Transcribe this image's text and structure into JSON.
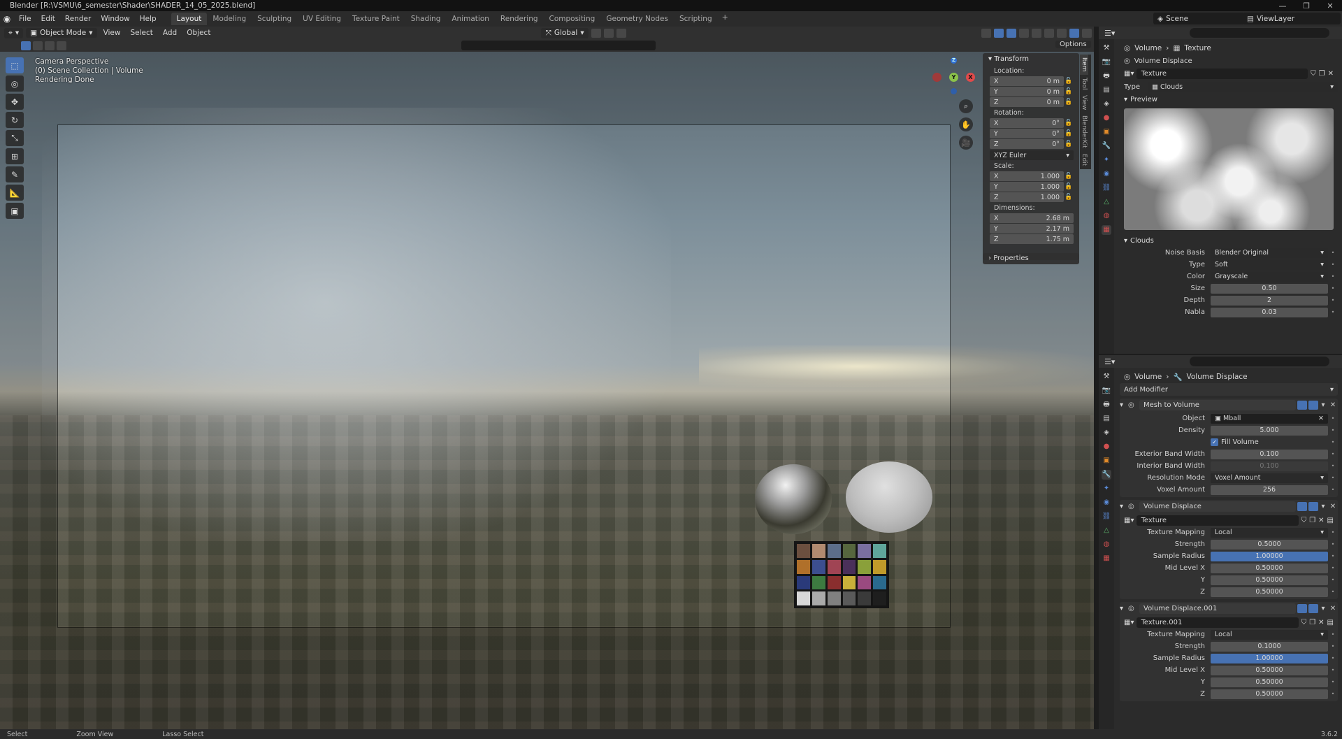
{
  "window": {
    "title": "Blender [R:\\VSMU\\6_semester\\Shader\\SHADER_14_05_2025.blend]",
    "buttons": [
      "—",
      "❐",
      "✕"
    ]
  },
  "menus": [
    "File",
    "Edit",
    "Render",
    "Window",
    "Help"
  ],
  "workspaces": [
    {
      "label": "Layout",
      "active": true
    },
    {
      "label": "Modeling"
    },
    {
      "label": "Sculpting"
    },
    {
      "label": "UV Editing"
    },
    {
      "label": "Texture Paint"
    },
    {
      "label": "Shading"
    },
    {
      "label": "Animation"
    },
    {
      "label": "Rendering"
    },
    {
      "label": "Compositing"
    },
    {
      "label": "Geometry Nodes"
    },
    {
      "label": "Scripting"
    }
  ],
  "scene": {
    "name": "Scene",
    "view_layer": "ViewLayer"
  },
  "viewport_header": {
    "mode": "Object Mode",
    "menus": [
      "View",
      "Select",
      "Add",
      "Object"
    ],
    "orientation": "Global",
    "options": "Options"
  },
  "viewport": {
    "info": [
      "Camera Perspective",
      "(0) Scene Collection | Volume",
      "Rendering Done"
    ],
    "gizmo": {
      "z": "Z",
      "y": "Y",
      "x": "X"
    }
  },
  "npanel": {
    "section": "Transform",
    "location_label": "Location:",
    "location": [
      {
        "axis": "X",
        "value": "0 m"
      },
      {
        "axis": "Y",
        "value": "0 m"
      },
      {
        "axis": "Z",
        "value": "0 m"
      }
    ],
    "rotation_label": "Rotation:",
    "rotation": [
      {
        "axis": "X",
        "value": "0°"
      },
      {
        "axis": "Y",
        "value": "0°"
      },
      {
        "axis": "Z",
        "value": "0°"
      }
    ],
    "rotation_mode": "XYZ Euler",
    "scale_label": "Scale:",
    "scale": [
      {
        "axis": "X",
        "value": "1.000"
      },
      {
        "axis": "Y",
        "value": "1.000"
      },
      {
        "axis": "Z",
        "value": "1.000"
      }
    ],
    "dimensions_label": "Dimensions:",
    "dimensions": [
      {
        "axis": "X",
        "value": "2.68 m"
      },
      {
        "axis": "Y",
        "value": "2.17 m"
      },
      {
        "axis": "Z",
        "value": "1.75 m"
      }
    ],
    "properties": "Properties",
    "tabs": [
      "Item",
      "Tool",
      "View",
      "BlenderKit",
      "Edit"
    ]
  },
  "texture_panel": {
    "crumb_object": "Volume",
    "crumb_item": "Texture",
    "modifier_name": "Volume Displace",
    "texture_name": "Texture",
    "type_label": "Type",
    "type_value": "Clouds",
    "preview_label": "Preview",
    "clouds_label": "Clouds",
    "props": [
      {
        "label": "Noise Basis",
        "value": "Blender Original",
        "kind": "select"
      },
      {
        "label": "Type",
        "value": "Soft",
        "kind": "select"
      },
      {
        "label": "Color",
        "value": "Grayscale",
        "kind": "select"
      },
      {
        "label": "Size",
        "value": "0.50",
        "kind": "num"
      },
      {
        "label": "Depth",
        "value": "2",
        "kind": "num"
      },
      {
        "label": "Nabla",
        "value": "0.03",
        "kind": "num"
      }
    ]
  },
  "modifier_panel": {
    "crumb_object": "Volume",
    "crumb_item": "Volume Displace",
    "add_modifier": "Add Modifier",
    "mesh_to_volume": {
      "name": "Mesh to Volume",
      "props": [
        {
          "label": "Object",
          "value": "Mball",
          "kind": "object"
        },
        {
          "label": "Density",
          "value": "5.000",
          "kind": "num"
        },
        {
          "label": "",
          "value": "Fill Volume",
          "kind": "check"
        },
        {
          "label": "Exterior Band Width",
          "value": "0.100",
          "kind": "num"
        },
        {
          "label": "Interior Band Width",
          "value": "0.100",
          "kind": "dim"
        },
        {
          "label": "Resolution Mode",
          "value": "Voxel Amount",
          "kind": "select"
        },
        {
          "label": "Voxel Amount",
          "value": "256",
          "kind": "num"
        }
      ]
    },
    "displace1": {
      "name": "Volume Displace",
      "texture": "Texture",
      "props": [
        {
          "label": "Texture Mapping",
          "value": "Local",
          "kind": "select"
        },
        {
          "label": "Strength",
          "value": "0.5000",
          "kind": "num"
        },
        {
          "label": "Sample Radius",
          "value": "1.00000",
          "kind": "blue"
        },
        {
          "label": "Mid Level X",
          "value": "0.50000",
          "kind": "num"
        },
        {
          "label": "Y",
          "value": "0.50000",
          "kind": "num"
        },
        {
          "label": "Z",
          "value": "0.50000",
          "kind": "num"
        }
      ]
    },
    "displace2": {
      "name": "Volume Displace.001",
      "texture": "Texture.001",
      "props": [
        {
          "label": "Texture Mapping",
          "value": "Local",
          "kind": "select"
        },
        {
          "label": "Strength",
          "value": "0.1000",
          "kind": "num"
        },
        {
          "label": "Sample Radius",
          "value": "1.00000",
          "kind": "blue"
        },
        {
          "label": "Mid Level X",
          "value": "0.50000",
          "kind": "num"
        },
        {
          "label": "Y",
          "value": "0.50000",
          "kind": "num"
        },
        {
          "label": "Z",
          "value": "0.50000",
          "kind": "num"
        }
      ]
    }
  },
  "statusbar": {
    "select": "Select",
    "zoom": "Zoom View",
    "lasso": "Lasso Select",
    "version": "3.6.2"
  },
  "colors": {
    "accent": "#4772b3",
    "panel": "#2b2b2b",
    "field": "#545454"
  }
}
